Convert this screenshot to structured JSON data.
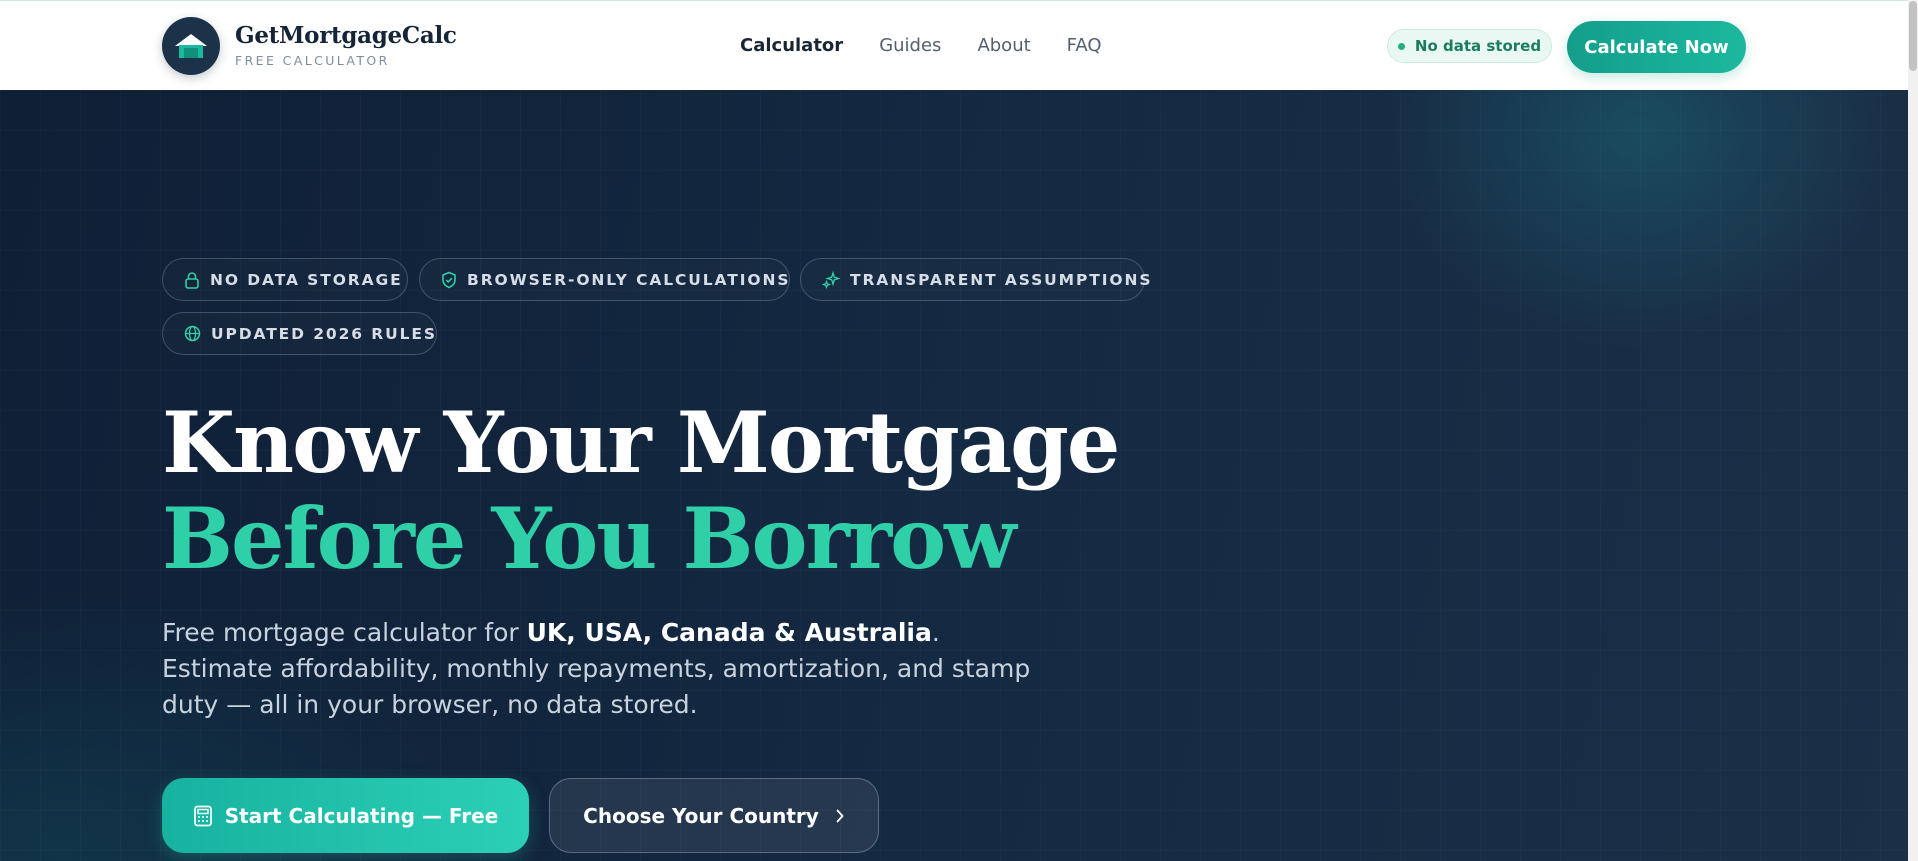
{
  "brand": {
    "name": "GetMortgageCalc",
    "tagline": "FREE CALCULATOR"
  },
  "nav": {
    "items": [
      {
        "label": "Calculator",
        "active": true
      },
      {
        "label": "Guides",
        "active": false
      },
      {
        "label": "About",
        "active": false
      },
      {
        "label": "FAQ",
        "active": false
      }
    ]
  },
  "header": {
    "privacy_pill": "No data stored",
    "cta_label": "Calculate Now"
  },
  "hero": {
    "badges": [
      {
        "label": "NO DATA STORAGE",
        "icon": "lock-icon"
      },
      {
        "label": "BROWSER-ONLY CALCULATIONS",
        "icon": "shield-check-icon"
      },
      {
        "label": "TRANSPARENT ASSUMPTIONS",
        "icon": "sparkles-icon"
      },
      {
        "label": "UPDATED 2026 RULES",
        "icon": "globe-icon"
      }
    ],
    "title_line1": "Know Your Mortgage",
    "title_line2": "Before You Borrow",
    "lede": {
      "intro": "Free mortgage calculator for ",
      "countries": "UK, USA, Canada & Australia",
      "rest": ". Estimate affordability, monthly repayments, amortization, and stamp duty — all in your browser, no data stored."
    },
    "primary_cta": "Start Calculating — Free",
    "secondary_cta": "Choose Your Country"
  },
  "colors": {
    "accent": "#1cb89e",
    "accent_text": "#2fcfa8",
    "hero_bg": "#142942",
    "header_bg": "#ffffff"
  }
}
